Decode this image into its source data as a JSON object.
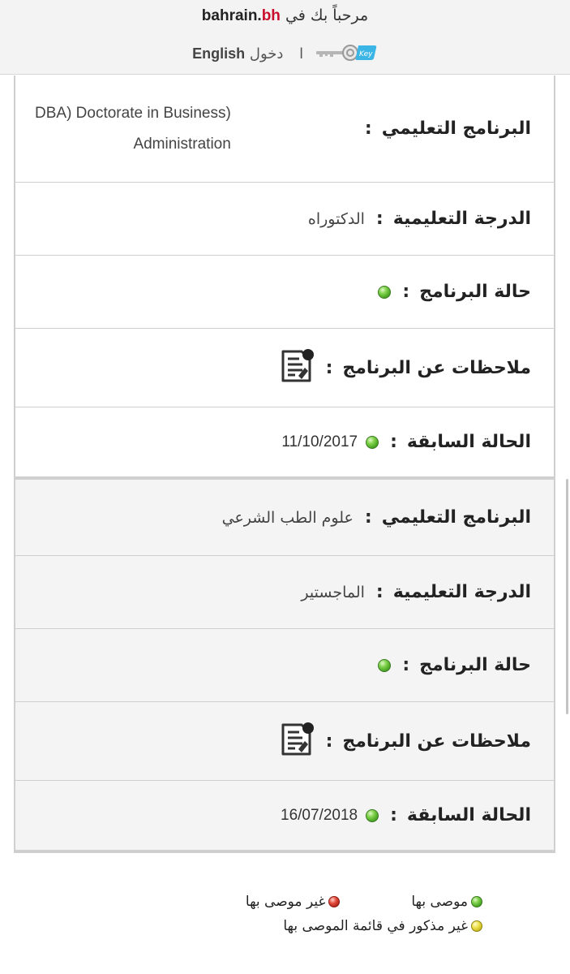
{
  "header": {
    "welcome": "مرحباً بك في",
    "brand_main": "bahrain.",
    "brand_tld": "bh",
    "language_link": "English",
    "separator": "ا",
    "login_label": "دخول",
    "key_icon": "key-icon",
    "key_badge": "Key"
  },
  "records": [
    {
      "program_label": "البرنامج التعليمي",
      "program_value_line1": "DBA) Doctorate in Business)",
      "program_value_line2": "Administration",
      "degree_label": "الدرجة التعليمية",
      "degree_value": "الدكتوراه",
      "status_label": "حالة البرنامج",
      "status_color": "green",
      "notes_label": "ملاحظات عن البرنامج",
      "notes_icon": "notes-document-icon",
      "previous_label": "الحالة السابقة",
      "previous_color": "green",
      "previous_date": "11/10/2017"
    },
    {
      "program_label": "البرنامج التعليمي",
      "program_value": "علوم الطب الشرعي",
      "degree_label": "الدرجة التعليمية",
      "degree_value": "الماجستير",
      "status_label": "حالة البرنامج",
      "status_color": "green",
      "notes_label": "ملاحظات عن البرنامج",
      "notes_icon": "notes-document-icon",
      "previous_label": "الحالة السابقة",
      "previous_color": "green",
      "previous_date": "16/07/2018"
    }
  ],
  "colon": ":",
  "legend": {
    "recommended": "موصى بها",
    "not_recommended": "غير موصى بها",
    "not_listed": "غير مذكور في قائمة الموصى بها",
    "colors": {
      "recommended": "#4caf28",
      "not_recommended": "#c62a1c",
      "not_listed": "#d9cc2a"
    }
  }
}
